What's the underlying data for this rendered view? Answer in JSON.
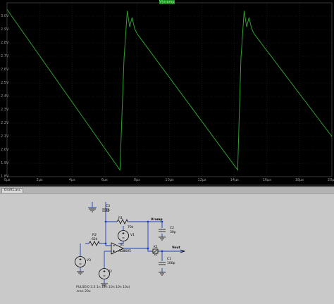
{
  "plot": {
    "trace_name": "V(vramp)",
    "y_ticks": [
      "3.0V",
      "2.9V",
      "2.8V",
      "2.7V",
      "2.6V",
      "2.5V",
      "2.4V",
      "2.3V",
      "2.2V",
      "2.1V",
      "2.0V",
      "1.9V",
      "1.8V"
    ],
    "x_ticks": [
      "0µs",
      "2µs",
      "4µs",
      "6µs",
      "8µs",
      "10µs",
      "12µs",
      "14µs",
      "16µs",
      "18µs",
      "20µs"
    ]
  },
  "chart_data": {
    "type": "line",
    "series": [
      {
        "name": "V(vramp)",
        "x": [
          0,
          6.95,
          7.2,
          7.4,
          7.55,
          7.7,
          7.85,
          8.0,
          14.2,
          14.4,
          14.6,
          14.75,
          14.9,
          15.05,
          15.2,
          20
        ],
        "y": [
          3.05,
          1.85,
          2.68,
          3.04,
          2.92,
          2.99,
          2.91,
          2.87,
          1.85,
          2.68,
          3.04,
          2.92,
          2.99,
          2.91,
          2.87,
          2.1
        ]
      }
    ],
    "xlabel": "",
    "ylabel": "",
    "xlim": [
      0,
      20
    ],
    "ylim": [
      1.8,
      3.1
    ],
    "grid": true,
    "colors": {
      "trace": "#2ea02e",
      "grid": "#1f2f1f",
      "background": "#000000"
    }
  },
  "schematic": {
    "tab_label": "Draft1.asc",
    "components": {
      "c3_name": "C3",
      "c3_value": "1p",
      "r1_name": "R1",
      "r1_value": "70k",
      "v1_name": "V1",
      "c2_name": "C2",
      "c2_value": "30p",
      "r2_name": "R2",
      "r2_value": "62k",
      "u1_name": "U1",
      "u1_value": "AD8605",
      "s1_name": "S1",
      "s1_prefix": "K1",
      "c1_name": "C1",
      "c1_value": "100p",
      "v3_name": "V3",
      "v2_name": "V2"
    },
    "nets": {
      "vramp": "Vramp",
      "vout": "Vout"
    },
    "directives": {
      "pulse": "PULSE(0 3.3 1n 10n 10n 10n 10u)",
      "tran": ".tran 20u"
    }
  }
}
